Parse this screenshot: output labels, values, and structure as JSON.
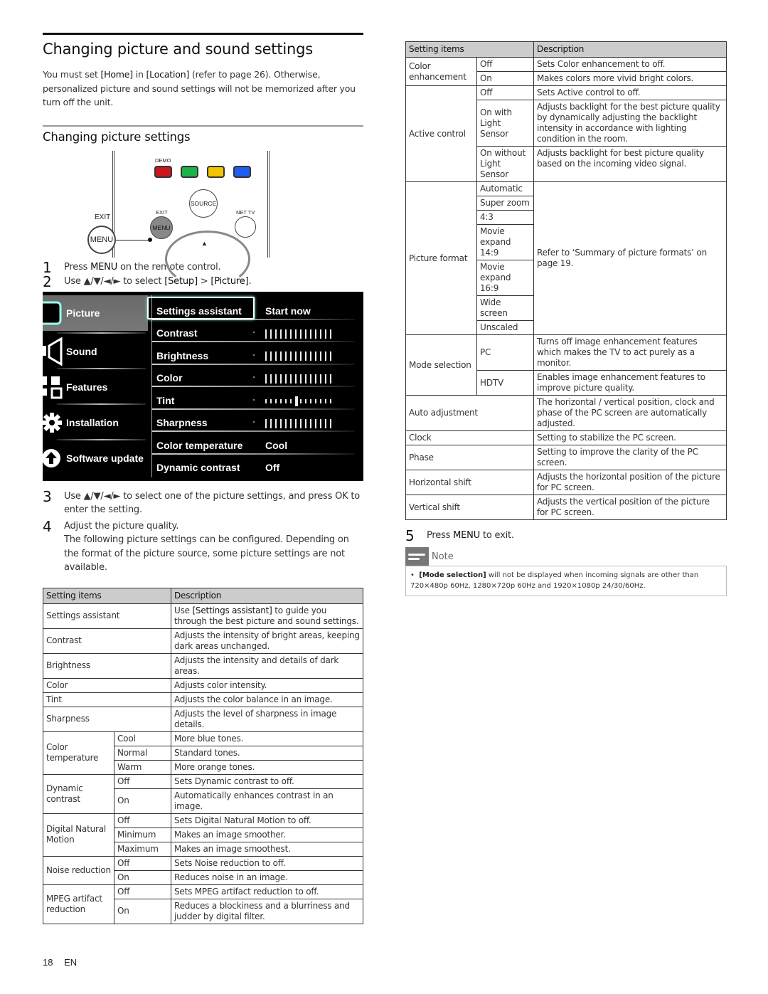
{
  "page": {
    "title": "Changing picture and sound settings",
    "intro": {
      "p1_pre": "You must set ",
      "home": "[Home]",
      "p1_mid": " in ",
      "location": "[Location]",
      "p1_post": " (refer to page 26). Otherwise, personalized picture and sound settings will not be memorized after you turn off the unit."
    },
    "subtitle": "Changing picture settings",
    "footer": {
      "page_number": "18",
      "lang": "EN"
    }
  },
  "remote": {
    "demo_label": "DEMO",
    "exit_label": "EXIT",
    "menu_label": "MENU",
    "source_label": "SOURCE",
    "nettv_label": "NET TV",
    "up_arrow": "▲",
    "colors": {
      "red": "#c8171d",
      "green": "#1bb24a",
      "yellow": "#f2c500",
      "blue": "#1f5ef0"
    }
  },
  "steps": [
    {
      "num": "1",
      "pre": "Press ",
      "key": "MENU",
      "post": " on the remote control."
    },
    {
      "num": "2",
      "pre": "Use ▲/▼/◄/► to select ",
      "key": "[Setup]",
      "mid": " > ",
      "key2": "[Picture]",
      "post": "."
    },
    {
      "num": "3",
      "text": "Use ▲/▼/◄/► to select one of the picture settings, and press OK to enter the setting."
    },
    {
      "num": "4",
      "text": "Adjust the picture quality.",
      "text2": "The following picture settings can be configured. Depending on the format of the picture source, some picture settings are not available."
    },
    {
      "num": "5",
      "pre": "Press ",
      "key": "MENU",
      "post": " to exit."
    }
  ],
  "tv_menu": {
    "categories": [
      {
        "label": "Picture",
        "icon": "picture-icon",
        "selected": true
      },
      {
        "label": "Sound",
        "icon": "speaker-icon",
        "selected": false
      },
      {
        "label": "Features",
        "icon": "features-icon",
        "selected": false
      },
      {
        "label": "Installation",
        "icon": "gear-icon",
        "selected": false
      },
      {
        "label": "Software update",
        "icon": "upload-icon",
        "selected": false
      }
    ],
    "items": [
      {
        "label": "Settings assistant",
        "value": "Start now",
        "focused": true
      },
      {
        "label": "Contrast",
        "slider_level": 1.0
      },
      {
        "label": "Brightness",
        "slider_level": 1.0
      },
      {
        "label": "Color",
        "slider_level": 1.0
      },
      {
        "label": "Tint",
        "slider_level": 0.5,
        "centered": true
      },
      {
        "label": "Sharpness",
        "slider_level": 1.0
      },
      {
        "label": "Color temperature",
        "value": "Cool"
      },
      {
        "label": "Dynamic contrast",
        "value": "Off"
      }
    ]
  },
  "table_left": {
    "headers": [
      "Setting items",
      "Description"
    ],
    "rows": [
      {
        "item": "Settings assistant",
        "desc_pre": "Use ",
        "desc_key": "[Settings assistant]",
        "desc_post": " to guide you through the best picture and sound settings."
      },
      {
        "item": "Contrast",
        "desc": "Adjusts the intensity of bright areas, keeping dark areas unchanged."
      },
      {
        "item": "Brightness",
        "desc": "Adjusts the intensity and details of dark areas."
      },
      {
        "item": "Color",
        "desc": "Adjusts color intensity."
      },
      {
        "item": "Tint",
        "desc": "Adjusts the color balance in an image."
      },
      {
        "item": "Sharpness",
        "desc": "Adjusts the level of sharpness in image details."
      }
    ],
    "groups": [
      {
        "item": "Color temperature",
        "options": [
          {
            "opt": "Cool",
            "desc": "More blue tones."
          },
          {
            "opt": "Normal",
            "desc": "Standard tones."
          },
          {
            "opt": "Warm",
            "desc": "More orange tones."
          }
        ]
      },
      {
        "item": "Dynamic contrast",
        "options": [
          {
            "opt": "Off",
            "desc": "Sets Dynamic contrast to off."
          },
          {
            "opt": "On",
            "desc": "Automatically enhances contrast in an image."
          }
        ]
      },
      {
        "item": "Digital Natural Motion",
        "options": [
          {
            "opt": "Off",
            "desc": "Sets Digital Natural Motion to off."
          },
          {
            "opt": "Minimum",
            "desc": "Makes an image smoother."
          },
          {
            "opt": "Maximum",
            "desc": "Makes an image smoothest."
          }
        ]
      },
      {
        "item": "Noise reduction",
        "options": [
          {
            "opt": "Off",
            "desc": "Sets Noise reduction to off."
          },
          {
            "opt": "On",
            "desc": "Reduces noise in an image."
          }
        ]
      },
      {
        "item": "MPEG artifact reduction",
        "options": [
          {
            "opt": "Off",
            "desc": "Sets MPEG artifact reduction to off."
          },
          {
            "opt": "On",
            "desc": "Reduces a blockiness and a blurriness and judder by digital filter."
          }
        ]
      }
    ]
  },
  "table_right": {
    "headers": [
      "Setting items",
      "Description"
    ],
    "color_enhancement": {
      "item": "Color enhancement",
      "options": [
        {
          "opt": "Off",
          "desc": "Sets Color enhancement to off."
        },
        {
          "opt": "On",
          "desc": "Makes colors more vivid bright colors."
        }
      ]
    },
    "active_control": {
      "item": "Active control",
      "options": [
        {
          "opt": "Off",
          "desc": "Sets Active control to off."
        },
        {
          "opt": "On with Light Sensor",
          "desc": "Adjusts backlight for the best picture quality by dynamically adjusting the backlight intensity in accordance with lighting condition in the room."
        },
        {
          "opt": "On without Light Sensor",
          "desc": "Adjusts backlight for best picture quality based on the incoming video signal."
        }
      ]
    },
    "picture_format": {
      "item": "Picture format",
      "options": [
        "Automatic",
        "Super zoom",
        "4:3",
        "Movie expand 14:9",
        "Movie expand 16:9",
        "Wide screen",
        "Unscaled"
      ],
      "desc": "Refer to ‘Summary of picture formats’ on page 19."
    },
    "mode_selection": {
      "item": "Mode selection",
      "options": [
        {
          "opt": "PC",
          "desc": "Turns off image enhancement features which makes the TV to act purely as a monitor."
        },
        {
          "opt": "HDTV",
          "desc": "Enables image enhancement features to improve picture quality."
        }
      ]
    },
    "rows": [
      {
        "item": "Auto adjustment",
        "desc": "The horizontal / vertical position, clock and phase of the PC screen are automatically adjusted."
      },
      {
        "item": "Clock",
        "desc": "Setting to stabilize the PC screen."
      },
      {
        "item": "Phase",
        "desc": "Setting to improve the clarity of the PC screen."
      },
      {
        "item": "Horizontal shift",
        "desc": "Adjusts the horizontal position of the picture for PC screen."
      },
      {
        "item": "Vertical shift",
        "desc": "Adjusts the vertical position of the picture for PC screen."
      }
    ]
  },
  "note": {
    "title": "Note",
    "bullet": "•",
    "key": "[Mode selection]",
    "text": " will not be displayed when incoming signals are other than 720×480p 60Hz, 1280×720p 60Hz and 1920×1080p 24/30/60Hz."
  }
}
